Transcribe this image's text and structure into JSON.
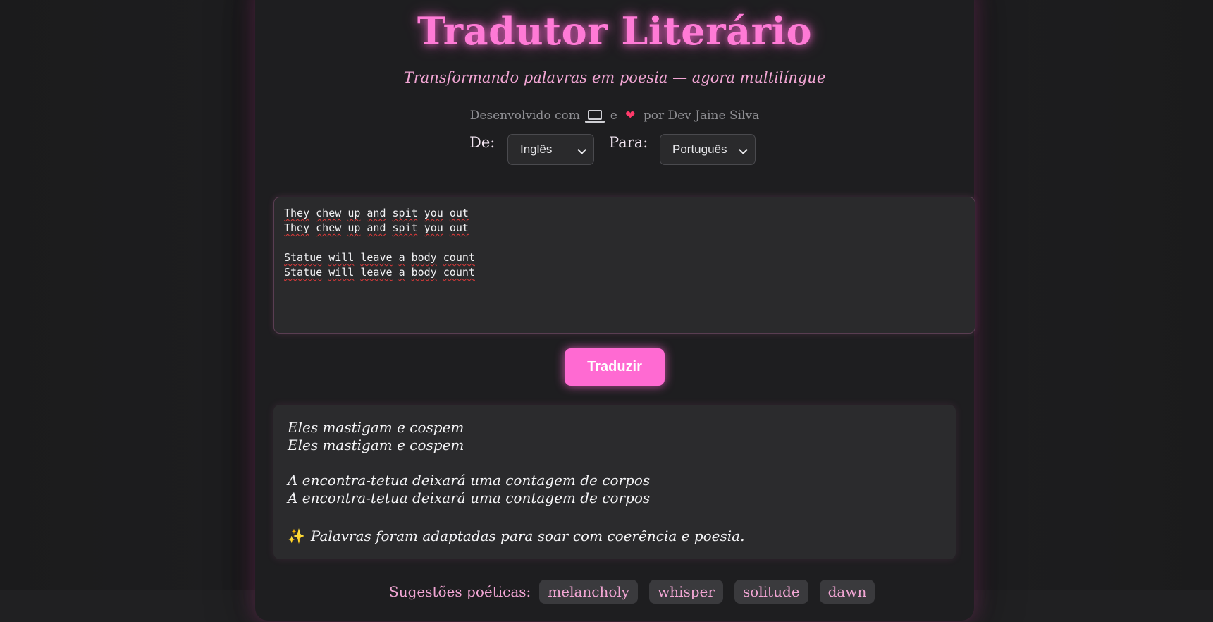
{
  "header": {
    "title": "Tradutor Literário",
    "subtitle": "Transformando palavras em poesia — agora multilíngue",
    "credit_prefix": "Desenvolvido com",
    "credit_and": "e",
    "credit_suffix": "por Dev Jaine Silva",
    "credit_icons": [
      "laptop-icon",
      "heart-icon"
    ]
  },
  "languages": {
    "from_label": "De:",
    "from_value": "Inglês",
    "to_label": "Para:",
    "to_value": "Português"
  },
  "source_text": {
    "lines": [
      "They chew up and spit you out",
      "They chew up and spit you out",
      "",
      "Statue will leave a body count",
      "Statue will leave a body count"
    ]
  },
  "translate_button": {
    "label": "Traduzir"
  },
  "output": {
    "lines": [
      "Eles mastigam e cospem",
      "Eles mastigam e cospem",
      "",
      "A encontra-tetua deixará uma contagem de corpos",
      "A encontra-tetua deixará uma contagem de corpos"
    ],
    "note": "Palavras foram adaptadas para soar com coerência e poesia.",
    "note_icon": "sparkles-icon"
  },
  "suggestions": {
    "label": "Sugestões poéticas:",
    "items": [
      "melancholy",
      "whisper",
      "solitude",
      "dawn"
    ]
  },
  "colors": {
    "accent_pink": "#ff6ad2",
    "title_pink": "#ff7ad6",
    "soft_pink": "#f2a6d4",
    "background": "#1c1c1e",
    "panel": "#2a2a2c"
  }
}
